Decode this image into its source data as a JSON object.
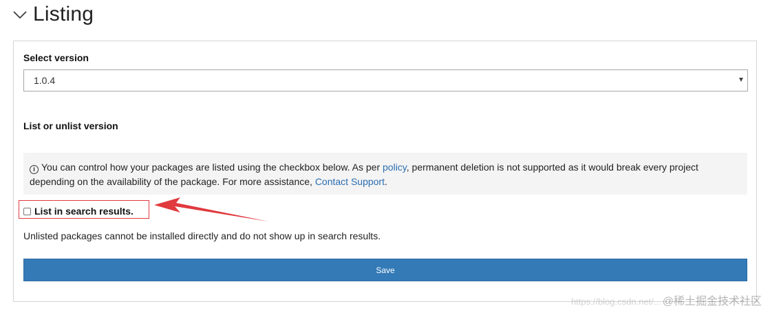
{
  "section": {
    "title": "Listing"
  },
  "select_version": {
    "label": "Select version",
    "selected": "1.0.4"
  },
  "list_unlist": {
    "label": "List or unlist version"
  },
  "info": {
    "text_1": "You can control how your packages are listed using the checkbox below. As per ",
    "policy_link": "policy",
    "text_2": ", permanent deletion is not supported as it would break every project depending on the availability of the package. For more assistance, ",
    "contact_link": "Contact Support",
    "text_3": "."
  },
  "checkbox": {
    "label": "List in search results.",
    "checked": false
  },
  "note": "Unlisted packages cannot be installed directly and do not show up in search results.",
  "save_label": "Save",
  "watermark": {
    "url": "https://blog.csdn.net/...",
    "brand": "@稀土掘金技术社区"
  },
  "colors": {
    "accent": "#337ab7",
    "link": "#2a6db0",
    "annotation": "#e0393e"
  }
}
